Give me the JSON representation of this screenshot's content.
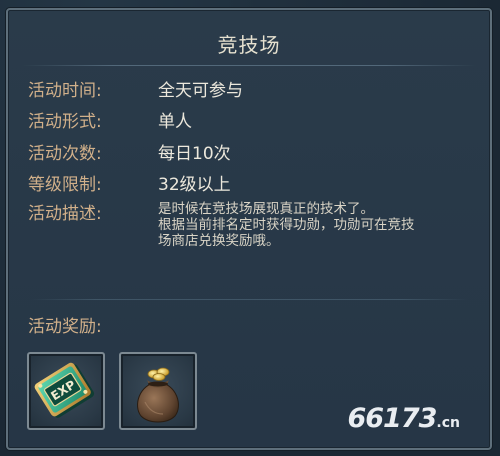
{
  "panel": {
    "title": "竞技场"
  },
  "info": {
    "time_label": "活动时间:",
    "time_value": "全天可参与",
    "form_label": "活动形式:",
    "form_value": "单人",
    "count_label": "活动次数:",
    "count_value": "每日10次",
    "level_label": "等级限制:",
    "level_value": "32级以上",
    "desc_label": "活动描述:",
    "desc_line1": "是时候在竞技场展现真正的技术了。",
    "desc_line2": "根据当前排名定时获得功勋，功勋可在竞技",
    "desc_line3": "场商店兑换奖励哦。"
  },
  "rewards": {
    "label": "活动奖励:",
    "items": [
      {
        "icon": "exp-book-icon"
      },
      {
        "icon": "coin-bag-icon"
      }
    ]
  },
  "watermark": {
    "main": "66173",
    "suffix": ".cn"
  },
  "colors": {
    "label": "#d1b08a",
    "value": "#ece8dc",
    "panel_bg": "#263646",
    "border": "#5e6f7b"
  }
}
